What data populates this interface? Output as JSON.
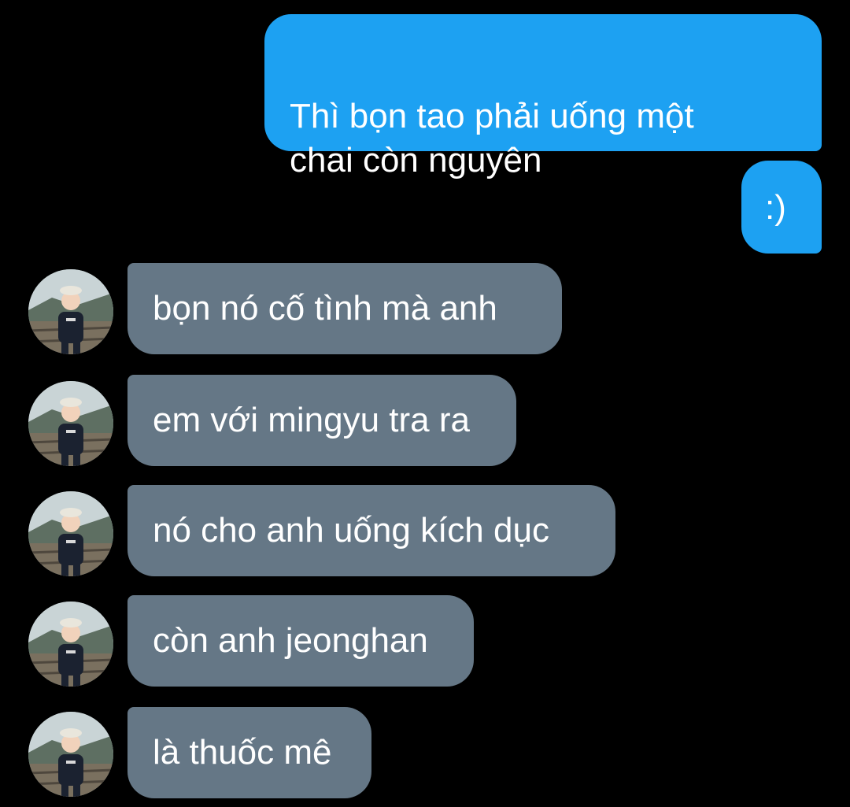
{
  "conversation": {
    "outgoing": [
      {
        "text": "Thì bọn tao phải uống một\nchai còn nguyên"
      },
      {
        "text": ":)"
      }
    ],
    "incoming": [
      {
        "text": "bọn nó cố tình mà anh"
      },
      {
        "text": "em với mingyu tra ra"
      },
      {
        "text": "nó cho anh uống kích dục"
      },
      {
        "text": "còn anh jeonghan"
      },
      {
        "text": "là thuốc mê"
      }
    ]
  },
  "colors": {
    "background": "#000000",
    "outgoing_bubble": "#1da1f2",
    "incoming_bubble": "#657786",
    "text": "#ffffff"
  },
  "icons": {
    "avatar": "child-avatar-icon"
  }
}
